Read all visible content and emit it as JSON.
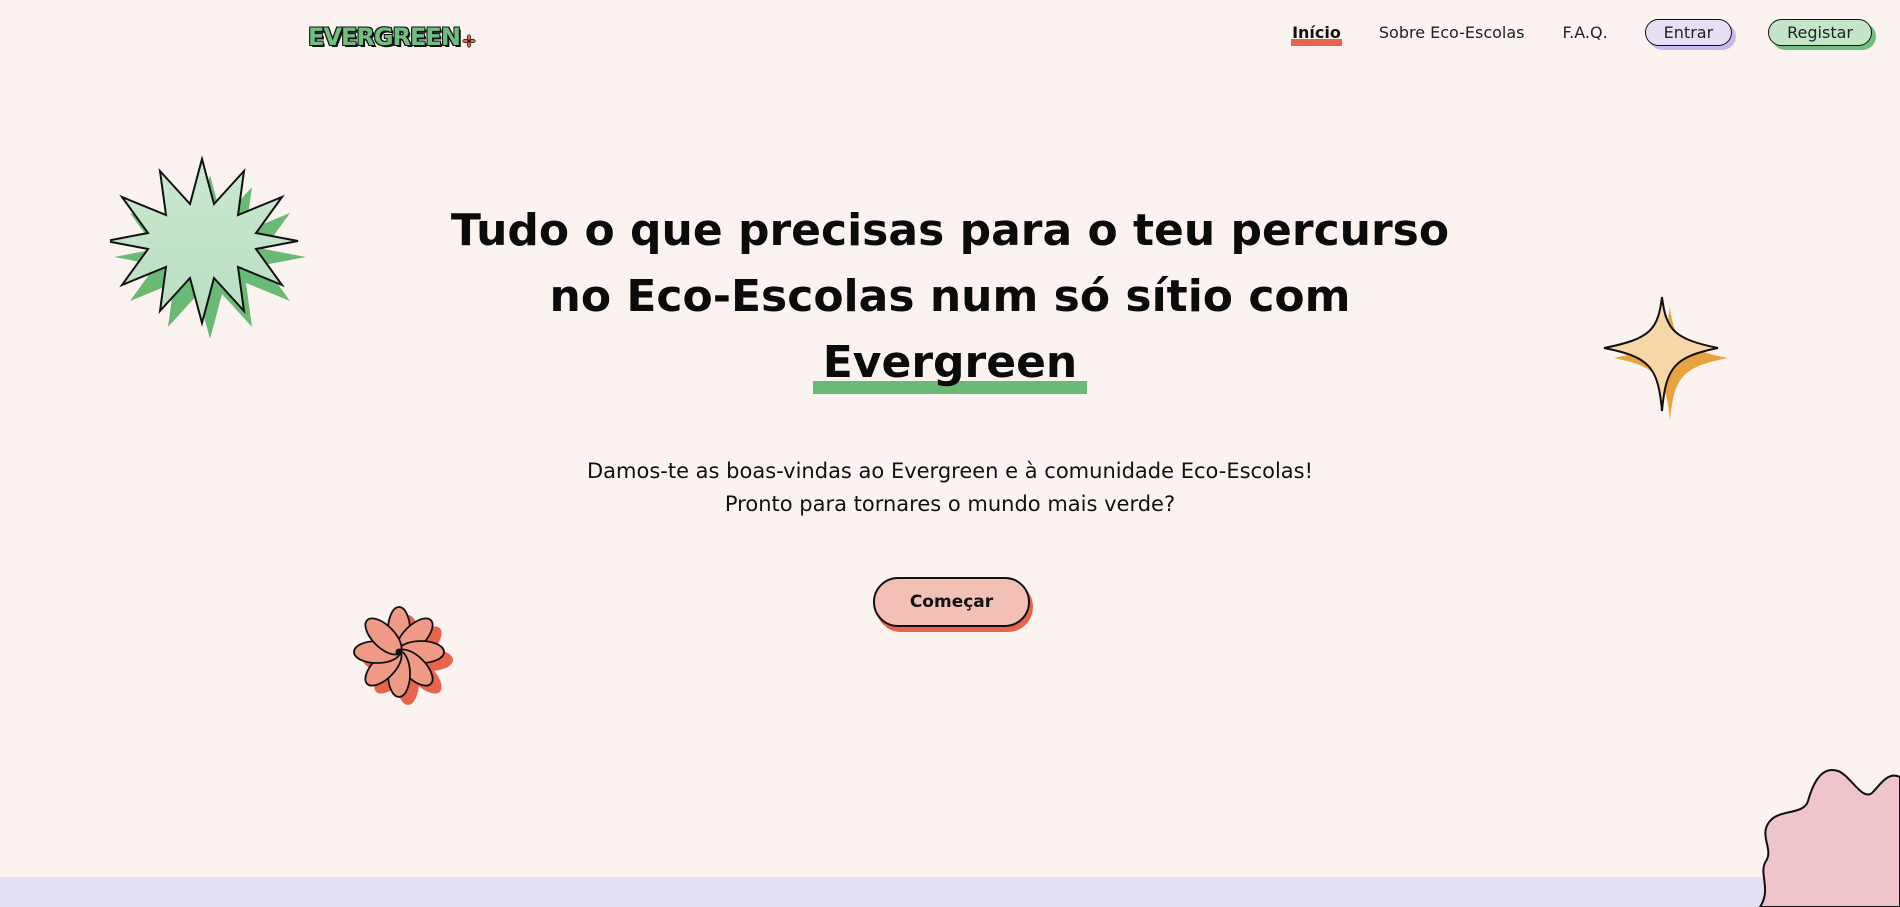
{
  "brand": {
    "logo_text": "EVERGREEN"
  },
  "nav": {
    "links": [
      {
        "label": "Início"
      },
      {
        "label": "Sobre Eco-Escolas"
      },
      {
        "label": "F.A.Q."
      }
    ],
    "login_label": "Entrar",
    "register_label": "Registar"
  },
  "hero": {
    "title_line1": "Tudo o que precisas para o teu percurso",
    "title_line2": "no Eco-Escolas num só sítio com",
    "title_highlight": "Evergreen",
    "subtitle_line1": "Damos-te as boas-vindas ao Evergreen e à comunidade Eco-Escolas!",
    "subtitle_line2": "Pronto para tornares o mundo mais verde?",
    "cta_label": "Começar"
  },
  "colors": {
    "background": "#fbf3f0",
    "green_accent": "#6aba76",
    "green_light": "#c3e5c8",
    "coral_accent": "#e8654d",
    "coral_light": "#f2c0b4",
    "lavender": "#e6e0f7",
    "orange_accent": "#e8a33d",
    "peach": "#f7d7a8",
    "pink": "#efc5cb"
  },
  "decorations": [
    "starburst-icon",
    "sparkle-icon",
    "flower-icon",
    "blob-shape"
  ]
}
